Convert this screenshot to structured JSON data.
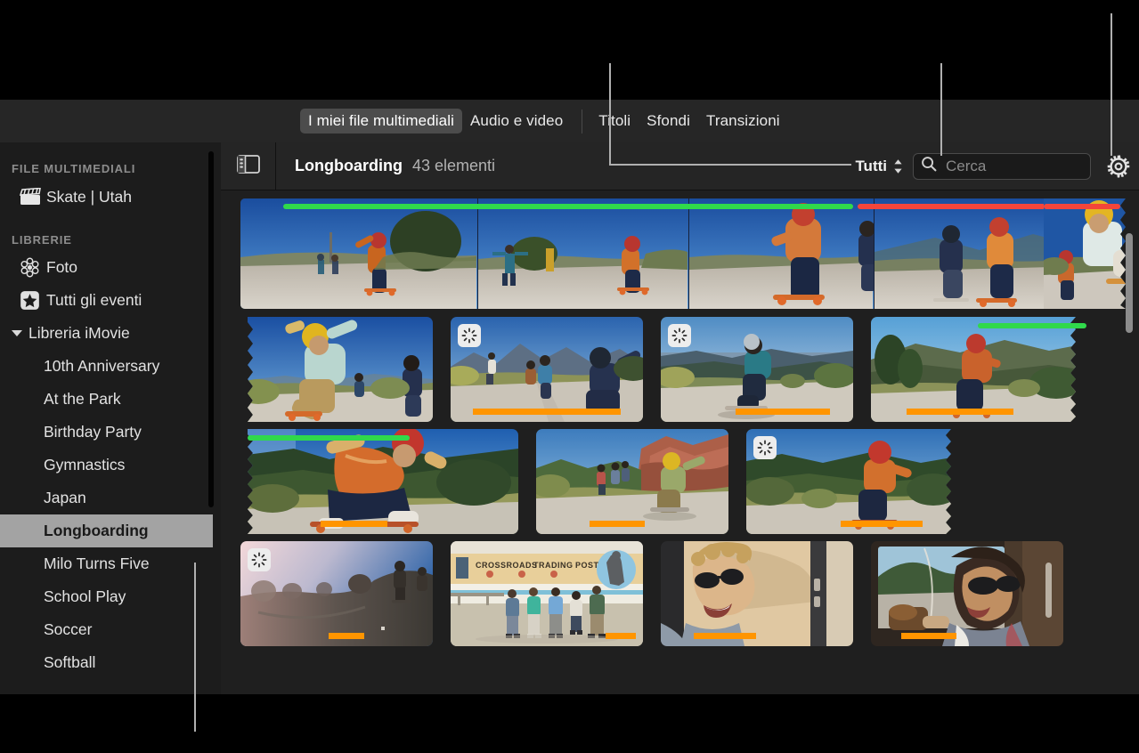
{
  "app": {
    "name": "iMovie",
    "language": "it"
  },
  "browser_tabs": {
    "items": [
      {
        "label": "I miei file multimediali",
        "active": true
      },
      {
        "label": "Audio e video",
        "active": false
      },
      {
        "label": "Titoli",
        "active": false
      },
      {
        "label": "Sfondi",
        "active": false
      },
      {
        "label": "Transizioni",
        "active": false
      }
    ],
    "separator_after_index": 1
  },
  "sidebar": {
    "sections": [
      {
        "header": "FILE MULTIMEDIALI",
        "items": [
          {
            "label": "Skate | Utah",
            "icon": "clapperboard-icon",
            "selected": false
          }
        ]
      },
      {
        "header": "LIBRERIE",
        "items": [
          {
            "label": "Foto",
            "icon": "photos-flower-icon",
            "selected": false
          },
          {
            "label": "Tutti gli eventi",
            "icon": "star-square-icon",
            "selected": false
          }
        ]
      }
    ],
    "library": {
      "label": "Libreria iMovie",
      "expanded": true,
      "disclosure_icon": "chevron-down-icon",
      "events": [
        {
          "label": "10th Anniversary",
          "selected": false
        },
        {
          "label": "At the Park",
          "selected": false
        },
        {
          "label": "Birthday Party",
          "selected": false
        },
        {
          "label": "Gymnastics",
          "selected": false
        },
        {
          "label": "Japan",
          "selected": false
        },
        {
          "label": "Longboarding",
          "selected": true
        },
        {
          "label": "Milo Turns Five",
          "selected": false
        },
        {
          "label": "School Play",
          "selected": false
        },
        {
          "label": "Soccer",
          "selected": false
        },
        {
          "label": "Softball",
          "selected": false
        }
      ]
    }
  },
  "toolbar": {
    "sidebar_toggle_icon": "sidebar-panel-icon",
    "title": "Longboarding",
    "count": "43 elementi",
    "filter": {
      "label": "Tutti",
      "stepper_icon": "stepper-updown-icon"
    },
    "search": {
      "placeholder": "Cerca",
      "value": "",
      "icon": "search-icon"
    },
    "settings_icon": "gear-icon"
  },
  "media_grid": {
    "colors": {
      "favorite_bar": "#30d94b",
      "rejected_bar": "#f4453a",
      "selection_bar": "#ff9500",
      "spinner_badge": "#ededed",
      "pane_background": "#1f1f1f",
      "toolbar_background": "#252525",
      "sidebar_background": "#1c1c1c",
      "selected_row": "#a3a3a3"
    },
    "rows": [
      {
        "row_index": 1,
        "filmstrip": true,
        "clips": [
          {
            "name": "longboard-rider-orange-shirt-1",
            "bars": [
              "green"
            ],
            "spinner": false,
            "continues_right": false
          },
          {
            "name": "longboard-rider-distance",
            "bars": [
              "green"
            ],
            "spinner": false,
            "continues_right": false
          },
          {
            "name": "longboard-rider-closeup",
            "bars": [
              "green"
            ],
            "spinner": false,
            "continues_right": false
          },
          {
            "name": "two-riders-descending",
            "bars": [
              "red"
            ],
            "spinner": false,
            "continues_right": false
          },
          {
            "name": "yellow-helmet-rider-crop",
            "bars": [
              "red"
            ],
            "spinner": false,
            "continues_right": true
          }
        ]
      },
      {
        "row_index": 2,
        "filmstrip": false,
        "clips": [
          {
            "name": "yellow-helmet-rider-carving",
            "bars": [],
            "spinner": false,
            "continues_left": true
          },
          {
            "name": "riders-mountain-road",
            "bars": [
              "orange"
            ],
            "spinner": true
          },
          {
            "name": "rider-valley-overlook",
            "bars": [
              "orange"
            ],
            "spinner": true
          },
          {
            "name": "rider-hillside-bend",
            "bars": [
              "green",
              "orange"
            ],
            "spinner": false,
            "continues_right": true
          }
        ]
      },
      {
        "row_index": 3,
        "filmstrip": false,
        "clips": [
          {
            "name": "crouching-rider-orange-shirt",
            "bars": [
              "green",
              "orange"
            ],
            "spinner": false,
            "continues_left": true
          },
          {
            "name": "red-rock-canyon-riders",
            "bars": [
              "orange"
            ],
            "spinner": false
          },
          {
            "name": "rider-red-helmet-roadside",
            "bars": [
              "orange"
            ],
            "spinner": true,
            "continues_right": true
          }
        ]
      },
      {
        "row_index": 4,
        "filmstrip": false,
        "clips": [
          {
            "name": "sunset-road-silhouette",
            "bars": [
              "orange"
            ],
            "spinner": true
          },
          {
            "name": "crossroads-trading-post-group",
            "bars": [
              "orange"
            ],
            "spinner": false,
            "sign_text": "CROSSROADS TRADING POST"
          },
          {
            "name": "man-sunglasses-in-van",
            "bars": [
              "orange"
            ],
            "spinner": false
          },
          {
            "name": "woman-sunglasses-in-van",
            "bars": [
              "orange"
            ],
            "spinner": false
          }
        ]
      }
    ],
    "scrollbar": {
      "name": "media-grid-scrollbar",
      "orientation": "vertical"
    }
  },
  "callouts": [
    {
      "name": "callout-filter",
      "target": "Tutti"
    },
    {
      "name": "callout-search",
      "target": "Cerca"
    },
    {
      "name": "callout-settings",
      "target": "gear-icon"
    },
    {
      "name": "callout-event-list",
      "target": "Longboarding"
    }
  ]
}
